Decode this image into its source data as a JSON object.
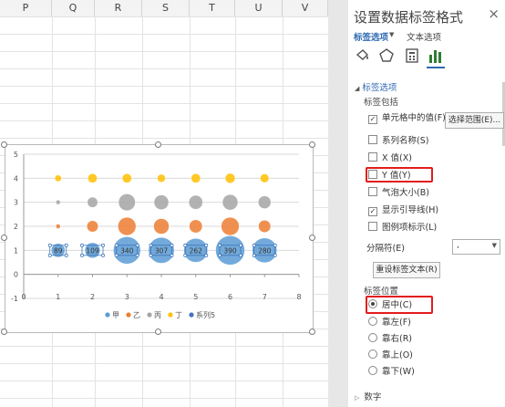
{
  "sheet": {
    "columns": [
      "P",
      "Q",
      "R",
      "S",
      "T",
      "U",
      "V"
    ]
  },
  "chart_data": {
    "type": "bubble",
    "xlim": [
      0,
      8
    ],
    "ylim": [
      -1,
      5
    ],
    "x_ticks": [
      "0",
      "1",
      "2",
      "3",
      "4",
      "5",
      "6",
      "7",
      "8"
    ],
    "y_ticks": [
      "-1",
      "0",
      "1",
      "2",
      "3",
      "4",
      "5"
    ],
    "x": [
      1,
      2,
      3,
      4,
      5,
      6,
      7
    ],
    "series": [
      {
        "name": "甲",
        "color": "#5b9bd5",
        "y": 1,
        "sizes": [
          89,
          109,
          340,
          307,
          262,
          390,
          280
        ],
        "labels": [
          "89",
          "109",
          "340",
          "307",
          "262",
          "390",
          "280"
        ]
      },
      {
        "name": "乙",
        "color": "#ed7d31",
        "y": 2,
        "sizes": [
          10,
          60,
          150,
          110,
          80,
          150,
          70
        ]
      },
      {
        "name": "丙",
        "color": "#a5a5a5",
        "y": 3,
        "sizes": [
          8,
          50,
          130,
          100,
          90,
          110,
          75
        ]
      },
      {
        "name": "丁",
        "color": "#ffc000",
        "y": 4,
        "sizes": [
          20,
          40,
          40,
          30,
          40,
          45,
          35
        ]
      },
      {
        "name": "系列5",
        "color": "#4472c4"
      }
    ],
    "legend_position": "bottom",
    "grid": true
  },
  "pane": {
    "title": "设置数据标签格式",
    "close": "×",
    "tab_label_options": "标签选项",
    "tab_text_options": "文本选项",
    "icons": [
      "fill-icon",
      "shape-icon",
      "size-properties-icon",
      "bar-chart-icon"
    ],
    "section_label_options": "标签选项",
    "label_contains": "标签包括",
    "checkboxes": [
      {
        "label": "单元格中的值(F)",
        "checked": true
      },
      {
        "label": "系列名称(S)",
        "checked": false
      },
      {
        "label": "X 值(X)",
        "checked": false
      },
      {
        "label": "Y 值(Y)",
        "checked": false
      },
      {
        "label": "气泡大小(B)",
        "checked": false
      },
      {
        "label": "显示引导线(H)",
        "checked": true
      },
      {
        "label": "图例项标示(L)",
        "checked": false
      }
    ],
    "select_range_button": "选择范围(E)...",
    "separator_label": "分隔符(E)",
    "separator_value": ",",
    "reset_button": "重设标签文本(R)",
    "label_position": "标签位置",
    "positions": [
      {
        "label": "居中(C)",
        "selected": true
      },
      {
        "label": "靠左(F)",
        "selected": false
      },
      {
        "label": "靠右(R)",
        "selected": false
      },
      {
        "label": "靠上(O)",
        "selected": false
      },
      {
        "label": "靠下(W)",
        "selected": false
      }
    ],
    "number_section": "数字"
  }
}
